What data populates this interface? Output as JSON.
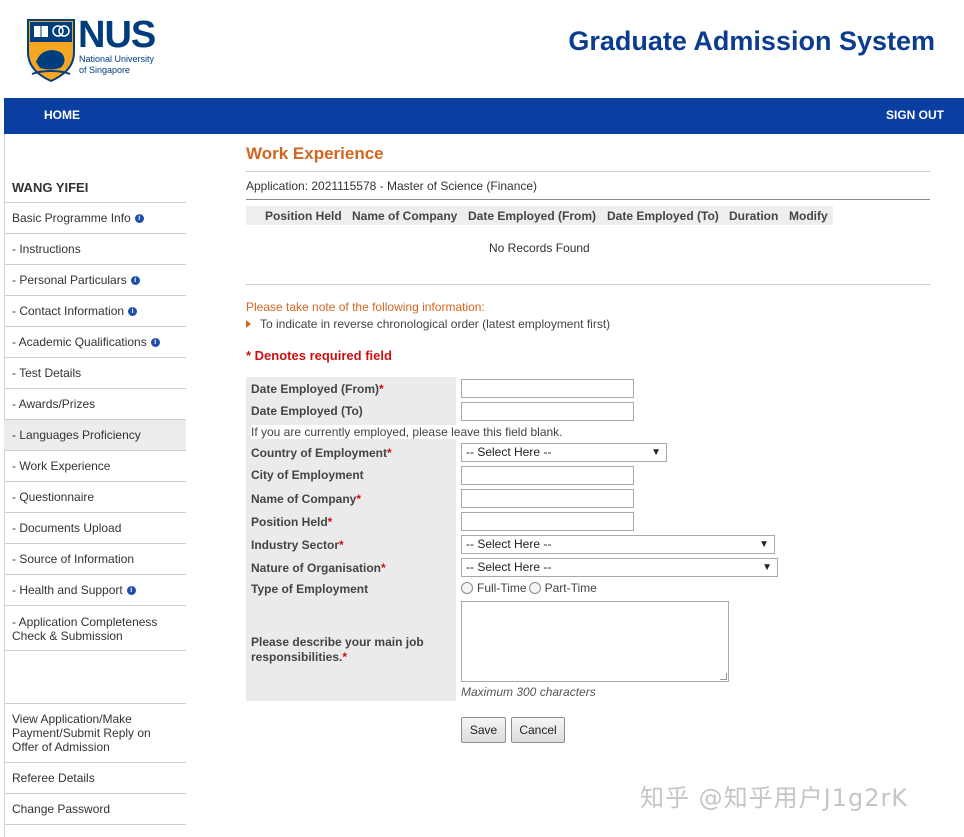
{
  "header": {
    "logo_text": "NUS",
    "logo_sub_line1": "National University",
    "logo_sub_line2": "of Singapore",
    "system_title": "Graduate Admission System"
  },
  "nav": {
    "home": "HOME",
    "sign_out": "SIGN OUT"
  },
  "sidebar": {
    "user_name": "WANG YIFEI",
    "items": [
      {
        "label": "Basic Programme Info",
        "info": true
      },
      {
        "label": "- Instructions",
        "info": false
      },
      {
        "label": "- Personal Particulars",
        "info": true
      },
      {
        "label": "- Contact Information",
        "info": true
      },
      {
        "label": "- Academic Qualifications",
        "info": true
      },
      {
        "label": "- Test Details",
        "info": false
      },
      {
        "label": "- Awards/Prizes",
        "info": false
      },
      {
        "label": "- Languages Proficiency",
        "info": false
      },
      {
        "label": "- Work Experience",
        "info": false
      },
      {
        "label": "- Questionnaire",
        "info": false
      },
      {
        "label": "- Documents Upload",
        "info": false
      },
      {
        "label": "- Source of Information",
        "info": false
      },
      {
        "label": "- Health and Support",
        "info": true
      },
      {
        "label": "- Application Completeness Check & Submission",
        "info": false
      }
    ],
    "bottom_items": [
      {
        "label": "View Application/Make Payment/Submit Reply on Offer of Admission"
      },
      {
        "label": "Referee Details"
      },
      {
        "label": "Change Password"
      }
    ]
  },
  "main": {
    "title": "Work Experience",
    "application_line": "Application: 2021115578 - Master of Science (Finance)",
    "table_headers": [
      "Position Held",
      "Name of Company",
      "Date Employed (From)",
      "Date Employed (To)",
      "Duration",
      "Modify"
    ],
    "no_records": "No Records Found",
    "note_title": "Please take note of the following information:",
    "note_item": "To indicate in reverse chronological order (latest employment first)",
    "required_note": "* Denotes required field"
  },
  "form": {
    "date_from_label": "Date Employed (From)",
    "date_to_label": "Date Employed (To)",
    "date_to_hint": "If you are currently employed, please leave this field blank.",
    "country_label": "Country of Employment",
    "country_value": "-- Select Here --",
    "city_label": "City of Employment",
    "company_label": "Name of Company",
    "position_label": "Position Held",
    "industry_label": "Industry Sector",
    "industry_value": "-- Select Here --",
    "nature_label": "Nature of Organisation",
    "nature_value": "-- Select Here --",
    "type_label": "Type of Employment",
    "type_fulltime": "Full-Time",
    "type_parttime": "Part-Time",
    "resp_label_line1": "Please describe your main job",
    "resp_label_line2": "responsibilities.",
    "max_chars": "Maximum 300 characters",
    "required_star": "*",
    "save": "Save",
    "cancel": "Cancel"
  },
  "watermark": "知乎 @知乎用户J1g2rK",
  "colors": {
    "nav_blue": "#0b3ea1",
    "title_orange": "#d2661f",
    "required_red": "#cc1111",
    "brand_blue": "#003d7c"
  }
}
